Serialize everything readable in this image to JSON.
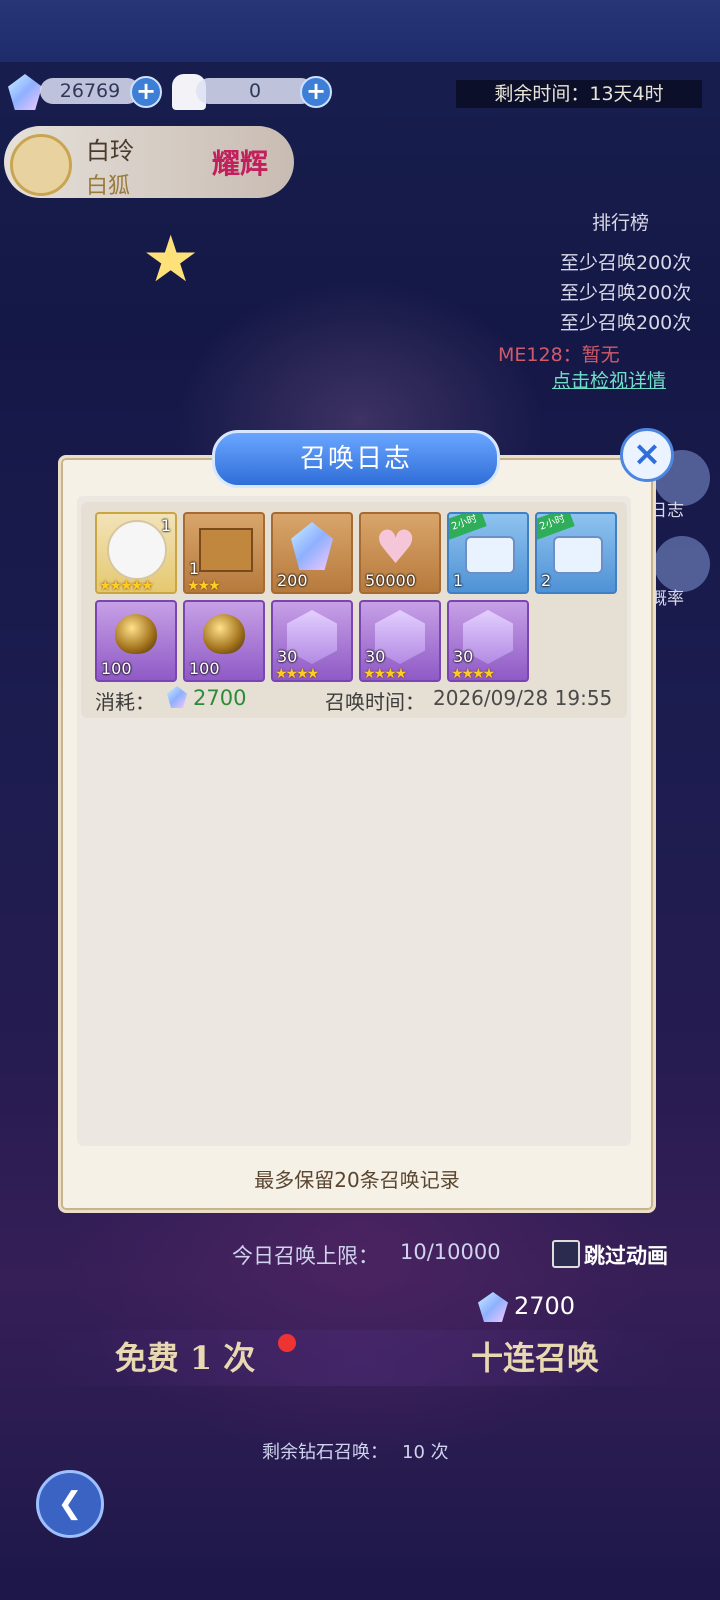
{
  "hud": {
    "gems": "26769",
    "wedding_count": "0",
    "remaining_time": "剩余时间：13天4时"
  },
  "character": {
    "name": "白玲",
    "sub": "白狐",
    "badge": "耀辉"
  },
  "ranking": {
    "title": "排行榜",
    "rows": [
      "至少召唤200次",
      "至少召唤200次",
      "至少召唤200次"
    ],
    "me": "ME128：暂无",
    "detail_link": "点击检视详情"
  },
  "side_buttons": {
    "log": "日志",
    "rate": "概率"
  },
  "bottom": {
    "daily_limit_label": "今日召唤上限：",
    "daily_limit_value": "10/10000",
    "skip_anim": "跳过动画",
    "cost": "2700",
    "free_once": "免费 1 次",
    "ten_pull": "十连召唤",
    "remaining_diamond": "剩余钻石召唤：",
    "remaining_diamond_value": "10 次"
  },
  "modal": {
    "title": "召唤日志",
    "close_icon": "close-x",
    "record": {
      "items": [
        {
          "kind": "character-portrait",
          "count": "1",
          "stars": "★★★★★"
        },
        {
          "kind": "mystery-box",
          "count": "1",
          "stars": "★★★"
        },
        {
          "kind": "crystal-gem",
          "count": "200"
        },
        {
          "kind": "exp-heart",
          "count": "50000"
        },
        {
          "kind": "treasure-chest-flower",
          "count": "1",
          "tag": "2小时"
        },
        {
          "kind": "treasure-chest-gold",
          "count": "2",
          "tag": "2小时"
        },
        {
          "kind": "golden-egg",
          "count": "100"
        },
        {
          "kind": "golden-egg",
          "count": "100"
        },
        {
          "kind": "silhouette-crystal",
          "count": "30",
          "stars": "★★★★"
        },
        {
          "kind": "silhouette-crystal",
          "count": "30",
          "stars": "★★★★"
        },
        {
          "kind": "silhouette-crystal",
          "count": "30",
          "stars": "★★★★"
        }
      ],
      "cost_label": "消耗：",
      "cost_value": "2700",
      "time_label": "召唤时间：",
      "time_value": "2026/09/28 19:55"
    },
    "footnote": "最多保留20条召唤记录"
  },
  "colors": {
    "modal_bg": "#f6f1e6",
    "title_blue": "#2f6ed8",
    "cost_green": "#2e8b3a"
  }
}
